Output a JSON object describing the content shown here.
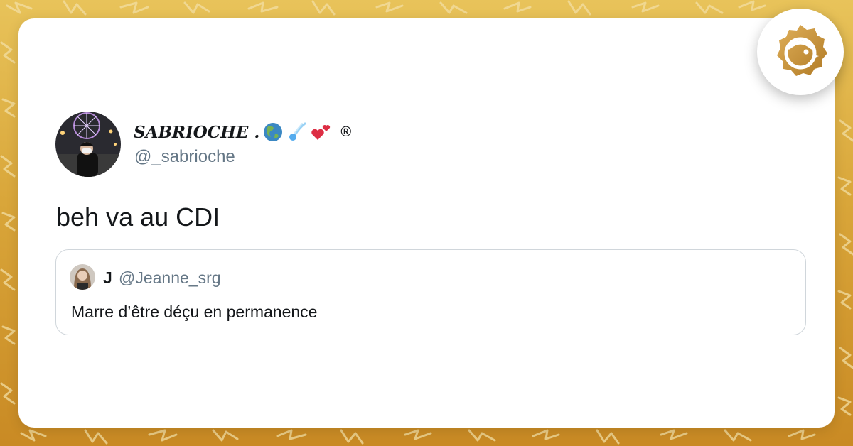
{
  "tweet": {
    "author": {
      "display_name": "SABRIOCHE .",
      "emojis": [
        "globe-americas-emoji",
        "comet-emoji",
        "two-hearts-emoji"
      ],
      "registered_mark": "®",
      "handle": "@_sabrioche"
    },
    "text": "beh va au CDI"
  },
  "quoted_tweet": {
    "author": {
      "display_name": "J",
      "handle": "@Jeanne_srg"
    },
    "text": "Marre d’être déçu en permanence"
  },
  "brand": {
    "logo": "brioche-logo-icon",
    "accent_color": "#c8923a"
  },
  "colors": {
    "background": "#d9a63a",
    "card": "#ffffff",
    "muted_text": "#657786",
    "text": "#14171a"
  }
}
